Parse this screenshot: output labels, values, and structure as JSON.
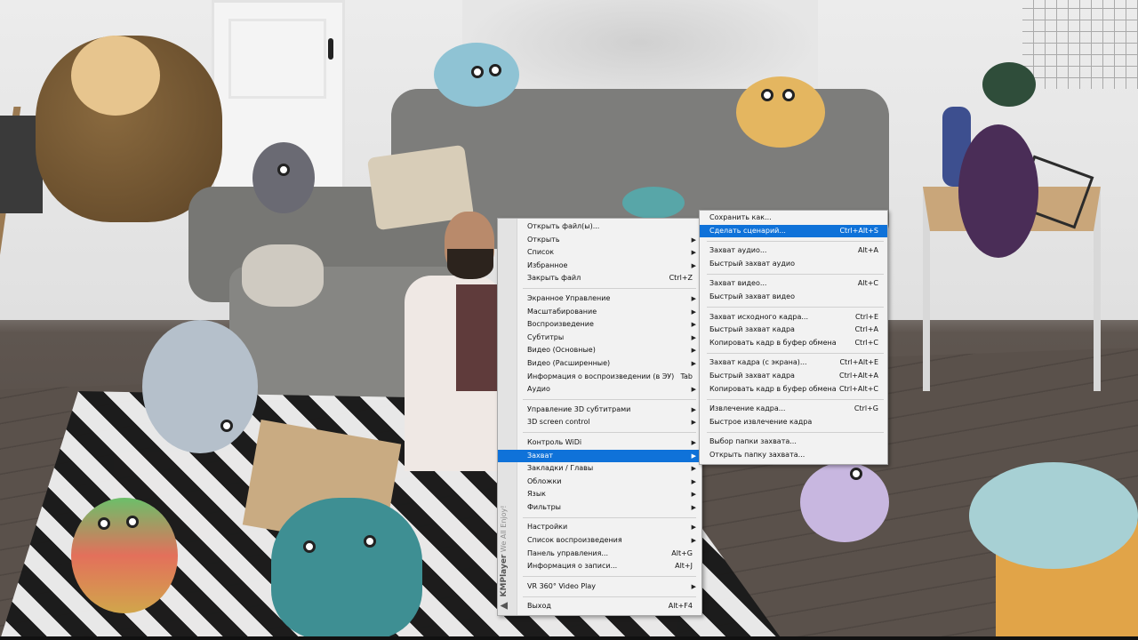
{
  "app": {
    "brand": "KMPlayer",
    "tagline": "We All Enjoy!"
  },
  "main_menu": {
    "items": [
      {
        "label": "Открыть файл(ы)...",
        "shortcut": "",
        "submenu": false
      },
      {
        "label": "Открыть",
        "shortcut": "",
        "submenu": true
      },
      {
        "label": "Список",
        "shortcut": "",
        "submenu": true
      },
      {
        "label": "Избранное",
        "shortcut": "",
        "submenu": true
      },
      {
        "label": "Закрыть файл",
        "shortcut": "Ctrl+Z",
        "submenu": false
      },
      {
        "sep": true
      },
      {
        "label": "Экранное Управление",
        "shortcut": "",
        "submenu": true
      },
      {
        "label": "Масштабирование",
        "shortcut": "",
        "submenu": true
      },
      {
        "label": "Воспроизведение",
        "shortcut": "",
        "submenu": true
      },
      {
        "label": "Субтитры",
        "shortcut": "",
        "submenu": true
      },
      {
        "label": "Видео (Основные)",
        "shortcut": "",
        "submenu": true
      },
      {
        "label": "Видео (Расширенные)",
        "shortcut": "",
        "submenu": true
      },
      {
        "label": "Информация о воспроизведении (в ЭУ)",
        "shortcut": "Tab",
        "submenu": false
      },
      {
        "label": "Аудио",
        "shortcut": "",
        "submenu": true
      },
      {
        "sep": true
      },
      {
        "label": "Управление 3D субтитрами",
        "shortcut": "",
        "submenu": true
      },
      {
        "label": "3D screen control",
        "shortcut": "",
        "submenu": true
      },
      {
        "sep": true
      },
      {
        "label": "Контроль WiDi",
        "shortcut": "",
        "submenu": true
      },
      {
        "label": "Захват",
        "shortcut": "",
        "submenu": true,
        "highlighted": true
      },
      {
        "label": "Закладки / Главы",
        "shortcut": "",
        "submenu": true
      },
      {
        "label": "Обложки",
        "shortcut": "",
        "submenu": true
      },
      {
        "label": "Язык",
        "shortcut": "",
        "submenu": true
      },
      {
        "label": "Фильтры",
        "shortcut": "",
        "submenu": true
      },
      {
        "sep": true
      },
      {
        "label": "Настройки",
        "shortcut": "",
        "submenu": true
      },
      {
        "label": "Список воспроизведения",
        "shortcut": "",
        "submenu": true
      },
      {
        "label": "Панель управления...",
        "shortcut": "Alt+G",
        "submenu": false
      },
      {
        "label": "Информация о записи...",
        "shortcut": "Alt+J",
        "submenu": false
      },
      {
        "sep": true
      },
      {
        "label": "VR 360° Video Play",
        "shortcut": "",
        "submenu": true
      },
      {
        "sep": true
      },
      {
        "label": "Выход",
        "shortcut": "Alt+F4",
        "submenu": false
      }
    ]
  },
  "capture_submenu": {
    "items": [
      {
        "label": "Сохранить как...",
        "shortcut": ""
      },
      {
        "label": "Сделать сценарий...",
        "shortcut": "Ctrl+Alt+S",
        "highlighted": true
      },
      {
        "sep": true
      },
      {
        "label": "Захват аудио...",
        "shortcut": "Alt+A"
      },
      {
        "label": "Быстрый захват аудио",
        "shortcut": ""
      },
      {
        "sep": true
      },
      {
        "label": "Захват видео...",
        "shortcut": "Alt+C"
      },
      {
        "label": "Быстрый захват видео",
        "shortcut": ""
      },
      {
        "sep": true
      },
      {
        "label": "Захват исходного кадра...",
        "shortcut": "Ctrl+E"
      },
      {
        "label": "Быстрый захват кадра",
        "shortcut": "Ctrl+A"
      },
      {
        "label": "Копировать кадр в буфер обмена",
        "shortcut": "Ctrl+C"
      },
      {
        "sep": true
      },
      {
        "label": "Захват кадра (с экрана)...",
        "shortcut": "Ctrl+Alt+E"
      },
      {
        "label": "Быстрый захват кадра",
        "shortcut": "Ctrl+Alt+A"
      },
      {
        "label": "Копировать кадр в буфер обмена",
        "shortcut": "Ctrl+Alt+C"
      },
      {
        "sep": true
      },
      {
        "label": "Извлечение кадра...",
        "shortcut": "Ctrl+G"
      },
      {
        "label": "Быстрое извлечение кадра",
        "shortcut": ""
      },
      {
        "sep": true
      },
      {
        "label": "Выбор папки захвата...",
        "shortcut": ""
      },
      {
        "label": "Открыть папку захвата...",
        "shortcut": ""
      }
    ]
  },
  "colors": {
    "highlight": "#0f72d9",
    "menu_bg": "#f2f2f2"
  },
  "icons": {
    "submenu_arrow": "chevron-right-icon"
  }
}
